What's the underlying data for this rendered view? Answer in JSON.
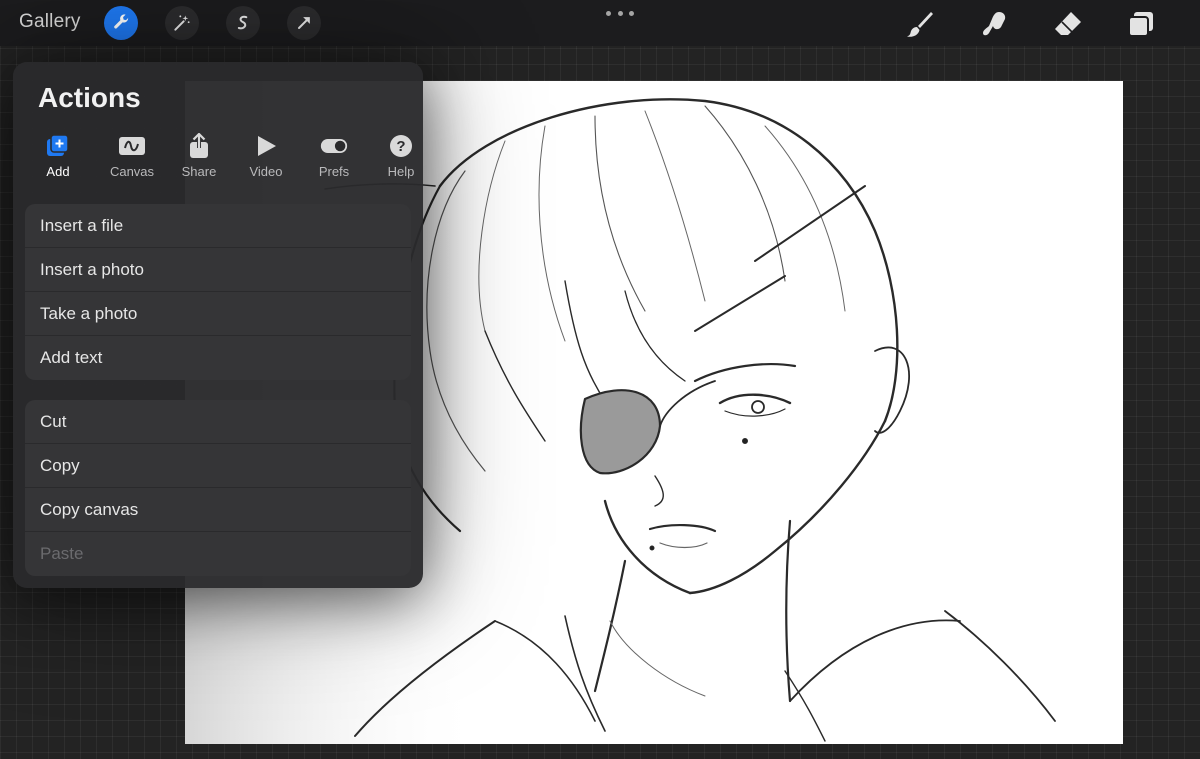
{
  "toolbar": {
    "gallery_label": "Gallery",
    "left_tools": [
      {
        "icon": "wrench-icon",
        "active": true
      },
      {
        "icon": "magic-wand-icon",
        "active": false
      },
      {
        "icon": "selection-icon",
        "active": false
      },
      {
        "icon": "transform-arrow-icon",
        "active": false
      }
    ],
    "right_tools": [
      "brush-icon",
      "smudge-icon",
      "eraser-icon",
      "layers-icon"
    ],
    "accent_color": "#1f79f2"
  },
  "actions": {
    "title": "Actions",
    "tabs": [
      {
        "label": "Add",
        "icon": "add-icon",
        "active": true
      },
      {
        "label": "Canvas",
        "icon": "canvas-icon",
        "active": false
      },
      {
        "label": "Share",
        "icon": "share-icon",
        "active": false
      },
      {
        "label": "Video",
        "icon": "video-play-icon",
        "active": false
      },
      {
        "label": "Prefs",
        "icon": "toggle-icon",
        "active": false
      },
      {
        "label": "Help",
        "icon": "help-icon",
        "active": false
      }
    ],
    "group1": [
      "Insert a file",
      "Insert a photo",
      "Take a photo",
      "Add text"
    ],
    "group2": [
      "Cut",
      "Copy",
      "Copy canvas",
      "Paste"
    ],
    "disabled_items": [
      "Paste"
    ]
  }
}
